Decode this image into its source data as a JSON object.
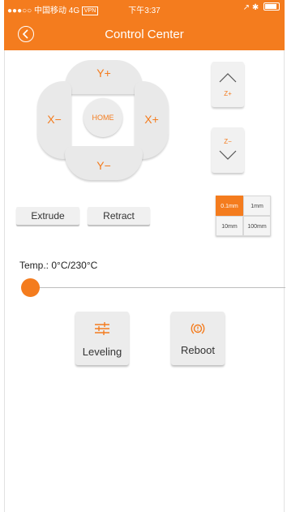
{
  "status_bar": {
    "carrier": "●●●○○ 中国移动 4G",
    "vpn": "VPN",
    "time": "下午3:37",
    "right": "↗ ✱"
  },
  "header": {
    "title": "Control Center",
    "back_icon": "chevron-left-circle-icon"
  },
  "dpad": {
    "y_plus": "Y+",
    "y_minus": "Y−",
    "x_minus": "X−",
    "x_plus": "X+",
    "home": "HOME"
  },
  "z_axis": {
    "up_label": "Z+",
    "down_label": "Z−"
  },
  "extruder": {
    "extrude_label": "Extrude",
    "retract_label": "Retract"
  },
  "step_sizes": [
    "0.1mm",
    "1mm",
    "10mm",
    "100mm"
  ],
  "selected_step": "0.1mm",
  "temperature": {
    "label": "Temp.: 0°C/230°C",
    "current": 0,
    "target": 230
  },
  "actions": {
    "leveling_label": "Leveling",
    "reboot_label": "Reboot"
  },
  "colors": {
    "accent": "#f47c1e",
    "button_bg": "#e9e9e9"
  }
}
